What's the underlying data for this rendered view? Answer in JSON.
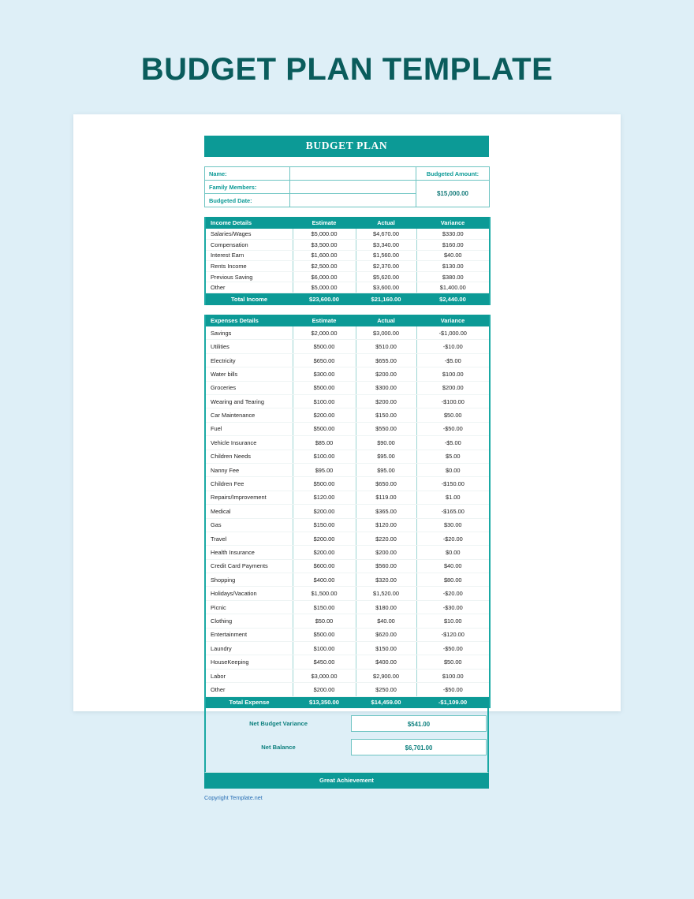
{
  "page": {
    "title": "BUDGET PLAN TEMPLATE",
    "copyright": "Copyright Template.net"
  },
  "sheet": {
    "title": "BUDGET PLAN",
    "info": {
      "name_label": "Name:",
      "name_value": "",
      "family_label": "Family Members:",
      "family_value": "",
      "date_label": "Budgeted Date:",
      "date_value": "",
      "budgeted_amount_label": "Budgeted Amount:",
      "budgeted_amount_value": "$15,000.00"
    },
    "income": {
      "headers": [
        "Income Details",
        "Estimate",
        "Actual",
        "Variance"
      ],
      "rows": [
        {
          "label": "Salaries/Wages",
          "estimate": "$5,000.00",
          "actual": "$4,670.00",
          "variance": "$330.00"
        },
        {
          "label": "Compensation",
          "estimate": "$3,500.00",
          "actual": "$3,340.00",
          "variance": "$160.00"
        },
        {
          "label": "Interest Earn",
          "estimate": "$1,600.00",
          "actual": "$1,560.00",
          "variance": "$40.00"
        },
        {
          "label": "Rents Income",
          "estimate": "$2,500.00",
          "actual": "$2,370.00",
          "variance": "$130.00"
        },
        {
          "label": "Previous Saving",
          "estimate": "$6,000.00",
          "actual": "$5,620.00",
          "variance": "$380.00"
        },
        {
          "label": "Other",
          "estimate": "$5,000.00",
          "actual": "$3,600.00",
          "variance": "$1,400.00"
        }
      ],
      "total": {
        "label": "Total Income",
        "estimate": "$23,600.00",
        "actual": "$21,160.00",
        "variance": "$2,440.00"
      }
    },
    "expenses": {
      "headers": [
        "Expenses Details",
        "Estimate",
        "Actual",
        "Variance"
      ],
      "rows": [
        {
          "label": "Savings",
          "estimate": "$2,000.00",
          "actual": "$3,000.00",
          "variance": "-$1,000.00"
        },
        {
          "label": "Utilities",
          "estimate": "$500.00",
          "actual": "$510.00",
          "variance": "-$10.00"
        },
        {
          "label": "Electricity",
          "estimate": "$650.00",
          "actual": "$655.00",
          "variance": "-$5.00"
        },
        {
          "label": "Water bills",
          "estimate": "$300.00",
          "actual": "$200.00",
          "variance": "$100.00"
        },
        {
          "label": "Groceries",
          "estimate": "$500.00",
          "actual": "$300.00",
          "variance": "$200.00"
        },
        {
          "label": "Wearing and Tearing",
          "estimate": "$100.00",
          "actual": "$200.00",
          "variance": "-$100.00"
        },
        {
          "label": "Car Maintenance",
          "estimate": "$200.00",
          "actual": "$150.00",
          "variance": "$50.00"
        },
        {
          "label": "Fuel",
          "estimate": "$500.00",
          "actual": "$550.00",
          "variance": "-$50.00"
        },
        {
          "label": "Vehicle Insurance",
          "estimate": "$85.00",
          "actual": "$90.00",
          "variance": "-$5.00"
        },
        {
          "label": "Children Needs",
          "estimate": "$100.00",
          "actual": "$95.00",
          "variance": "$5.00"
        },
        {
          "label": "Nanny Fee",
          "estimate": "$95.00",
          "actual": "$95.00",
          "variance": "$0.00"
        },
        {
          "label": "Children Fee",
          "estimate": "$500.00",
          "actual": "$650.00",
          "variance": "-$150.00"
        },
        {
          "label": "Repairs/Improvement",
          "estimate": "$120.00",
          "actual": "$119.00",
          "variance": "$1.00"
        },
        {
          "label": "Medical",
          "estimate": "$200.00",
          "actual": "$365.00",
          "variance": "-$165.00"
        },
        {
          "label": "Gas",
          "estimate": "$150.00",
          "actual": "$120.00",
          "variance": "$30.00"
        },
        {
          "label": "Travel",
          "estimate": "$200.00",
          "actual": "$220.00",
          "variance": "-$20.00"
        },
        {
          "label": "Health Insurance",
          "estimate": "$200.00",
          "actual": "$200.00",
          "variance": "$0.00"
        },
        {
          "label": "Credit Card Payments",
          "estimate": "$600.00",
          "actual": "$560.00",
          "variance": "$40.00"
        },
        {
          "label": "Shopping",
          "estimate": "$400.00",
          "actual": "$320.00",
          "variance": "$80.00"
        },
        {
          "label": "Holidays/Vacation",
          "estimate": "$1,500.00",
          "actual": "$1,520.00",
          "variance": "-$20.00"
        },
        {
          "label": "Picnic",
          "estimate": "$150.00",
          "actual": "$180.00",
          "variance": "-$30.00"
        },
        {
          "label": "Clothing",
          "estimate": "$50.00",
          "actual": "$40.00",
          "variance": "$10.00"
        },
        {
          "label": "Entertainment",
          "estimate": "$500.00",
          "actual": "$620.00",
          "variance": "-$120.00"
        },
        {
          "label": "Laundry",
          "estimate": "$100.00",
          "actual": "$150.00",
          "variance": "-$50.00"
        },
        {
          "label": "HouseKeeping",
          "estimate": "$450.00",
          "actual": "$400.00",
          "variance": "$50.00"
        },
        {
          "label": "Labor",
          "estimate": "$3,000.00",
          "actual": "$2,900.00",
          "variance": "$100.00"
        },
        {
          "label": "Other",
          "estimate": "$200.00",
          "actual": "$250.00",
          "variance": "-$50.00"
        }
      ],
      "total": {
        "label": "Total Expense",
        "estimate": "$13,350.00",
        "actual": "$14,459.00",
        "variance": "-$1,109.00"
      }
    },
    "summary": {
      "net_variance_label": "Net Budget Variance",
      "net_variance_value": "$541.00",
      "net_balance_label": "Net Balance",
      "net_balance_value": "$6,701.00",
      "achievement": "Great Achievement"
    }
  },
  "colors": {
    "teal": "#0c9a96",
    "dark_teal": "#0a5c5c",
    "page_bg": "#deeff7",
    "link": "#2a6fb5"
  }
}
